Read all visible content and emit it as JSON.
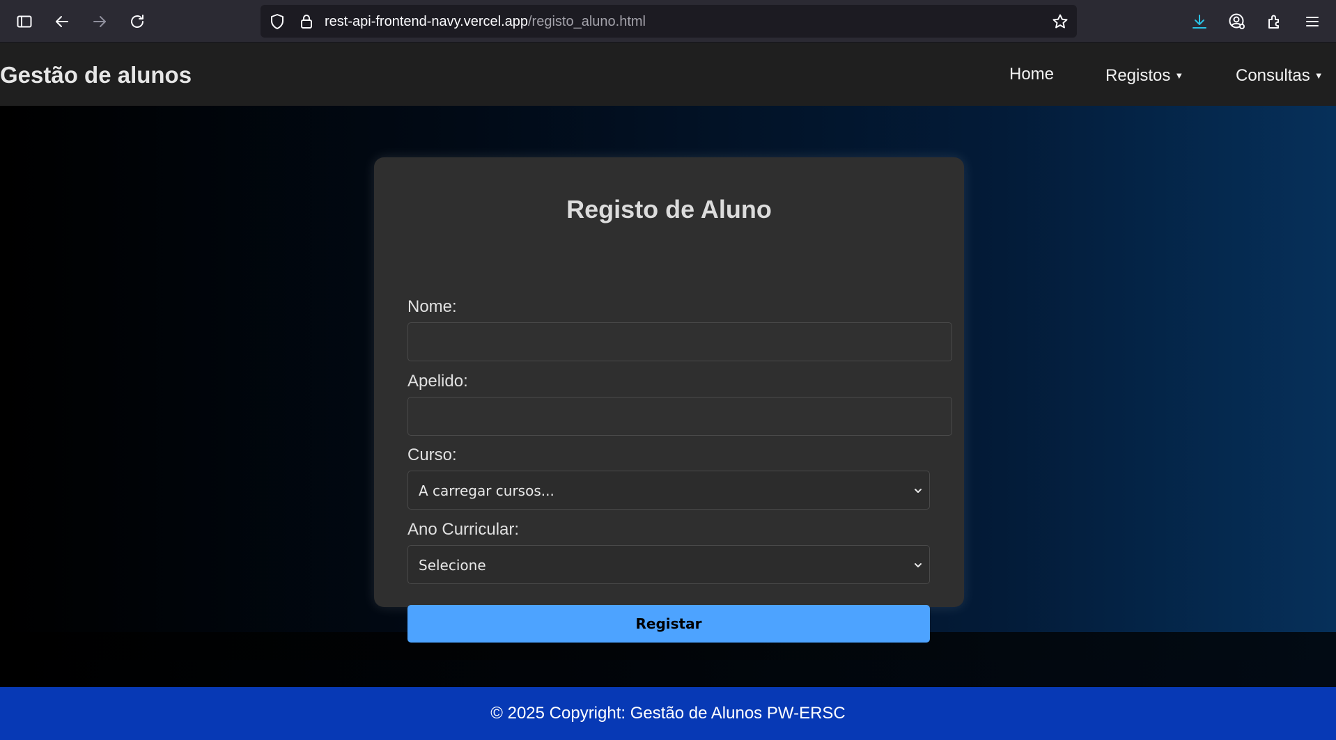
{
  "browser": {
    "url_host": "rest-api-frontend-navy.vercel.app",
    "url_path": "/registo_aluno.html",
    "icons": [
      "sidebar-icon",
      "back-arrow-icon",
      "forward-arrow-icon",
      "reload-icon",
      "shield-icon",
      "lock-icon",
      "star-icon",
      "download-icon",
      "account-icon",
      "extensions-icon",
      "menu-icon"
    ],
    "accent_color": "#2ac3e6"
  },
  "navbar": {
    "brand": "Gestão de alunos",
    "items": [
      {
        "label": "Home"
      },
      {
        "label": "Registos",
        "caret": "▼"
      },
      {
        "label": "Consultas",
        "caret": "▼"
      }
    ]
  },
  "form": {
    "title": "Registo de Aluno",
    "nome_label": "Nome:",
    "nome_value": "",
    "apelido_label": "Apelido:",
    "apelido_value": "",
    "curso_label": "Curso:",
    "curso_selected": "A carregar cursos...",
    "ano_label": "Ano Curricular:",
    "ano_selected": "Selecione",
    "submit_label": "Registar",
    "button_color": "#4da3ff"
  },
  "footer": {
    "text": "© 2025 Copyright: Gestão de Alunos PW-ERSC",
    "color": "#0739b5"
  }
}
